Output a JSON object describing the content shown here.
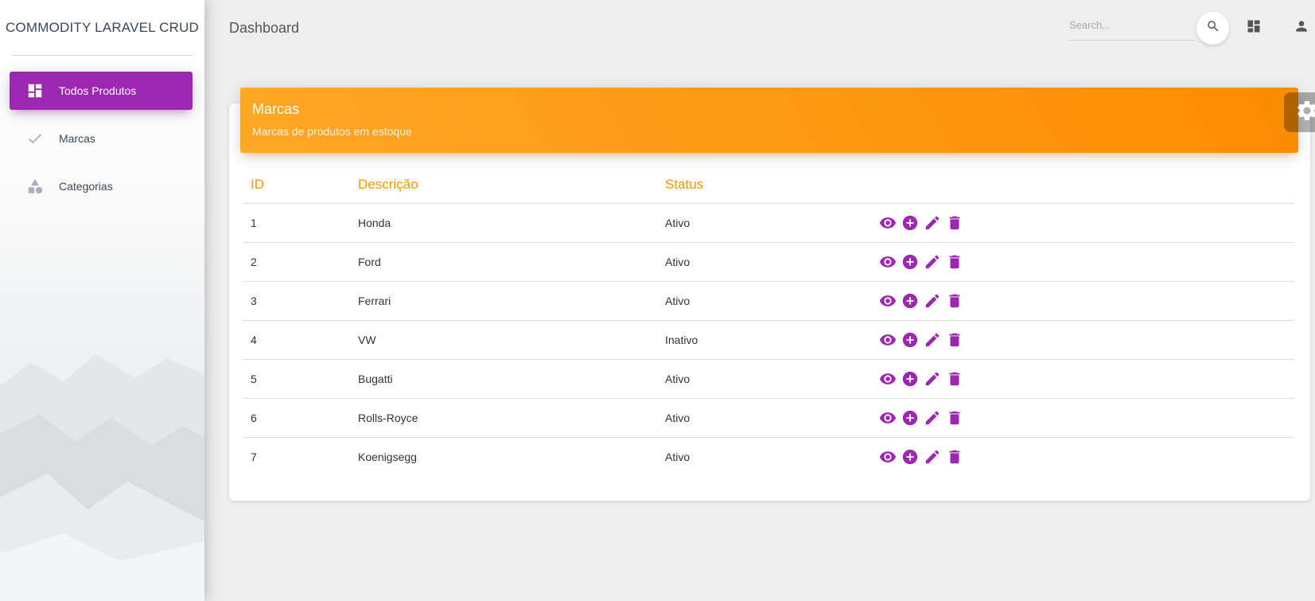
{
  "sidebar": {
    "brand": "COMMODITY LARAVEL CRUD",
    "items": [
      {
        "label": "Todos Produtos",
        "icon": "dashboard-icon",
        "active": true
      },
      {
        "label": "Marcas",
        "icon": "check-icon",
        "active": false
      },
      {
        "label": "Categorias",
        "icon": "category-icon",
        "active": false
      }
    ]
  },
  "header": {
    "title": "Dashboard",
    "search_placeholder": "Search...",
    "icons": [
      "search-icon",
      "dashboard-icon",
      "person-icon"
    ]
  },
  "card": {
    "title": "Marcas",
    "subtitle": "Marcas de produtos em estoque"
  },
  "table": {
    "columns": [
      "ID",
      "Descrição",
      "Status",
      ""
    ],
    "rows": [
      {
        "id": "1",
        "descricao": "Honda",
        "status": "Ativo"
      },
      {
        "id": "2",
        "descricao": "Ford",
        "status": "Ativo"
      },
      {
        "id": "3",
        "descricao": "Ferrari",
        "status": "Ativo"
      },
      {
        "id": "4",
        "descricao": "VW",
        "status": "Inativo"
      },
      {
        "id": "5",
        "descricao": "Bugatti",
        "status": "Ativo"
      },
      {
        "id": "6",
        "descricao": "Rolls-Royce",
        "status": "Ativo"
      },
      {
        "id": "7",
        "descricao": "Koenigsegg",
        "status": "Ativo"
      }
    ],
    "row_actions": [
      "view-icon",
      "add-circle-icon",
      "edit-icon",
      "delete-icon"
    ]
  },
  "colors": {
    "primary": "#9c27b0",
    "header_start": "#ffa726",
    "header_end": "#fb8c00",
    "table_header_text": "#ff9800"
  }
}
